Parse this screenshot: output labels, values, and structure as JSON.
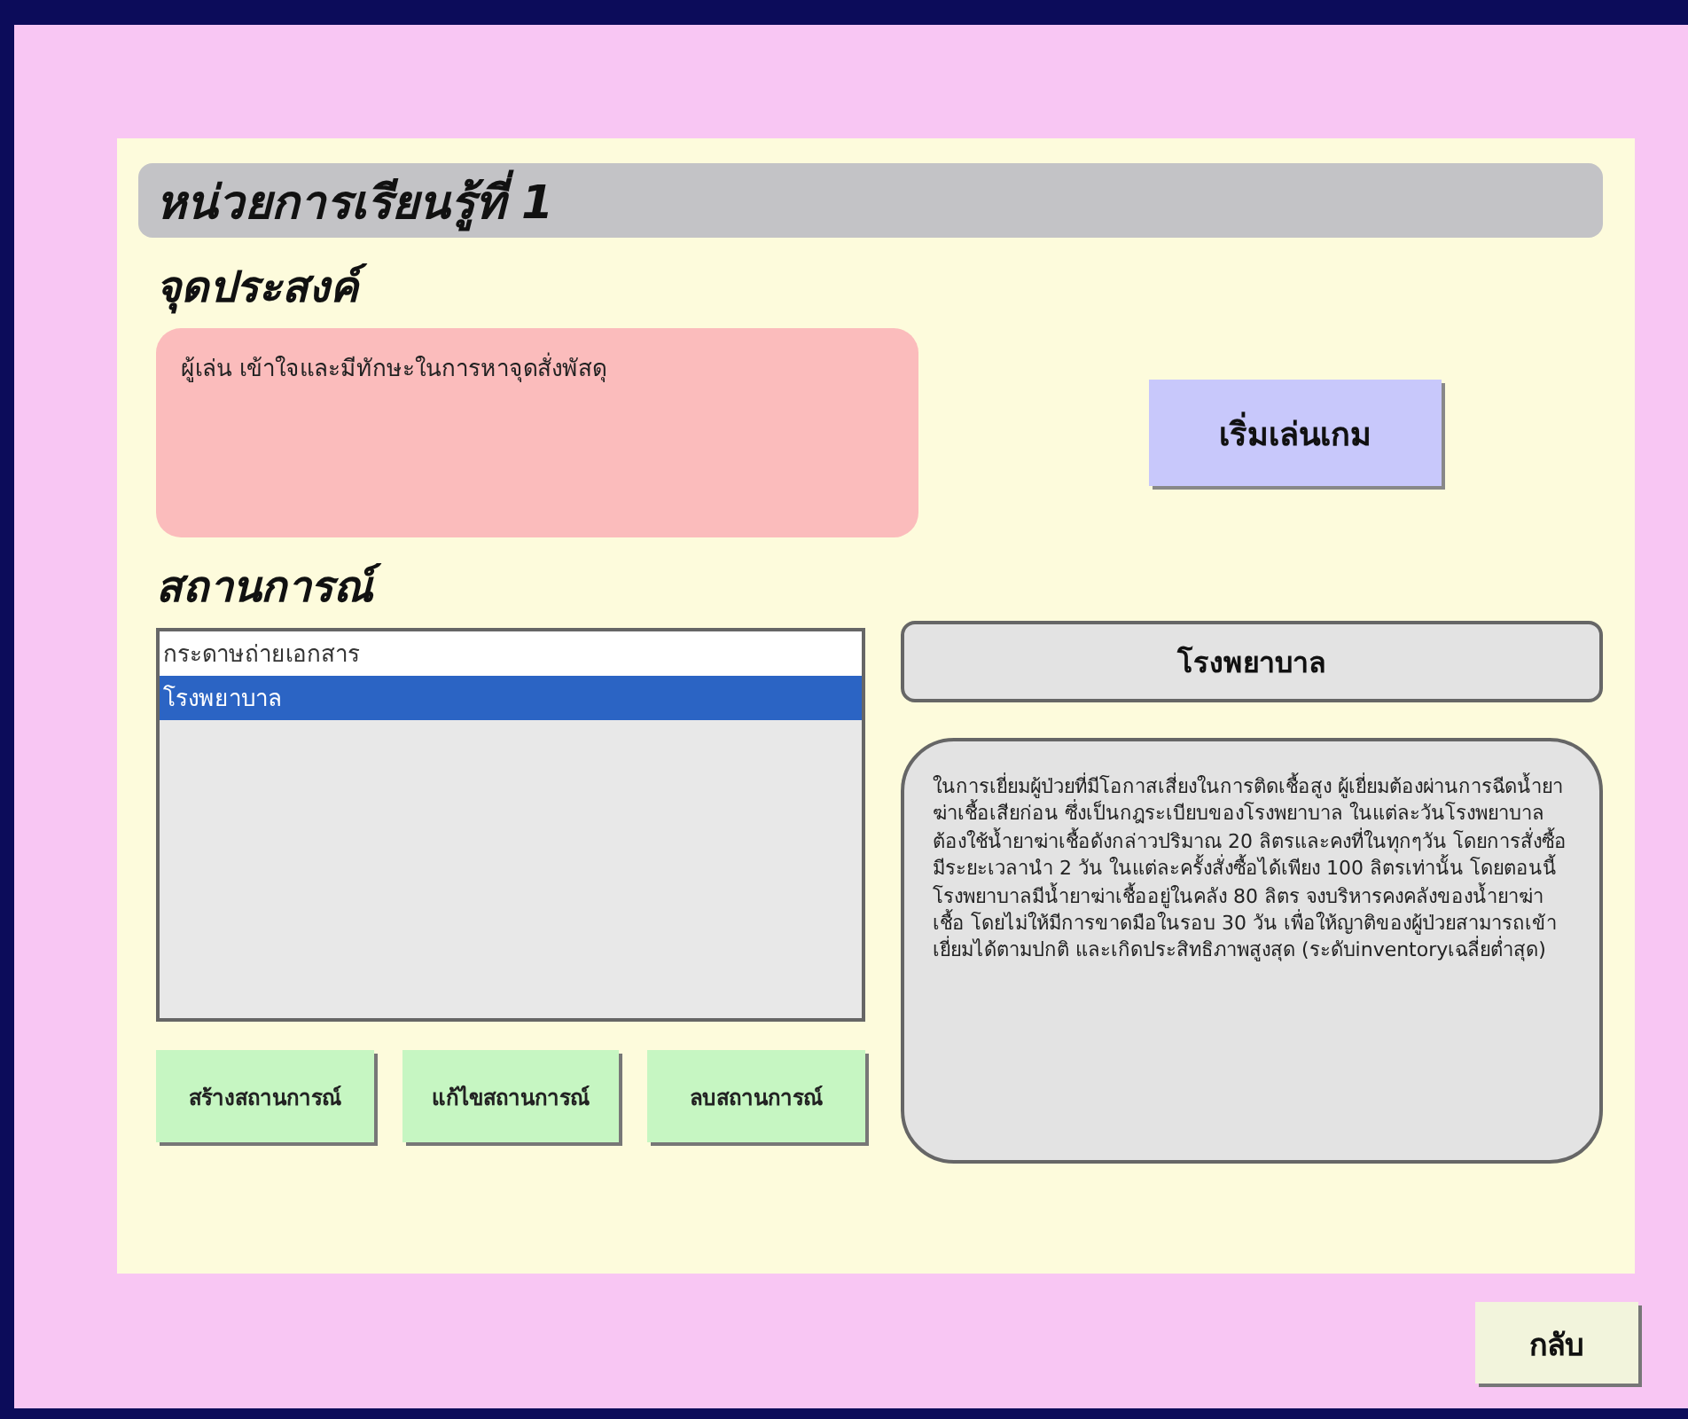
{
  "unit_title": "หน่วยการเรียนรู้ที่ 1",
  "objective": {
    "heading": "จุดประสงค์",
    "text": "ผู้เล่น เข้าใจและมีทักษะในการหาจุดสั่งพัสดุ"
  },
  "start_button": "เริ่มเล่นเกม",
  "scenarios": {
    "heading": "สถานการณ์",
    "items": [
      {
        "label": "กระดาษถ่ายเอกสาร",
        "selected": false
      },
      {
        "label": "โรงพยาบาล",
        "selected": true
      }
    ]
  },
  "detail": {
    "title": "โรงพยาบาล",
    "description": "ในการเยี่ยมผู้ป่วยที่มีโอกาสเสี่ยงในการติดเชื้อสูง ผู้เยี่ยมต้องผ่านการฉีดน้ำยาฆ่าเชื้อเสียก่อน ซึ่งเป็นกฎระเบียบของโรงพยาบาล ในแต่ละวันโรงพยาบาลต้องใช้น้ำยาฆ่าเชื้อดังกล่าวปริมาณ 20 ลิตรและคงที่ในทุกๆวัน โดยการสั่งซื้อมีระยะเวลานำ 2 วัน ในแต่ละครั้งสั่งซื้อได้เพียง 100 ลิตรเท่านั้น โดยตอนนี้โรงพยาบาลมีน้ำยาฆ่าเชื้ออยู่ในคลัง 80 ลิตร จงบริหารคงคลังของน้ำยาฆ่าเชื้อ โดยไม่ให้มีการขาดมือในรอบ 30 วัน เพื่อให้ญาติของผู้ป่วยสามารถเข้าเยี่ยมได้ตามปกติ และเกิดประสิทธิภาพสูงสุด (ระดับinventoryเฉลี่ยต่ำสุด)"
  },
  "scenario_buttons": [
    "สร้างสถานการณ์",
    "แก้ไขสถานการณ์",
    "ลบสถานการณ์"
  ],
  "back_button": "กลับ"
}
